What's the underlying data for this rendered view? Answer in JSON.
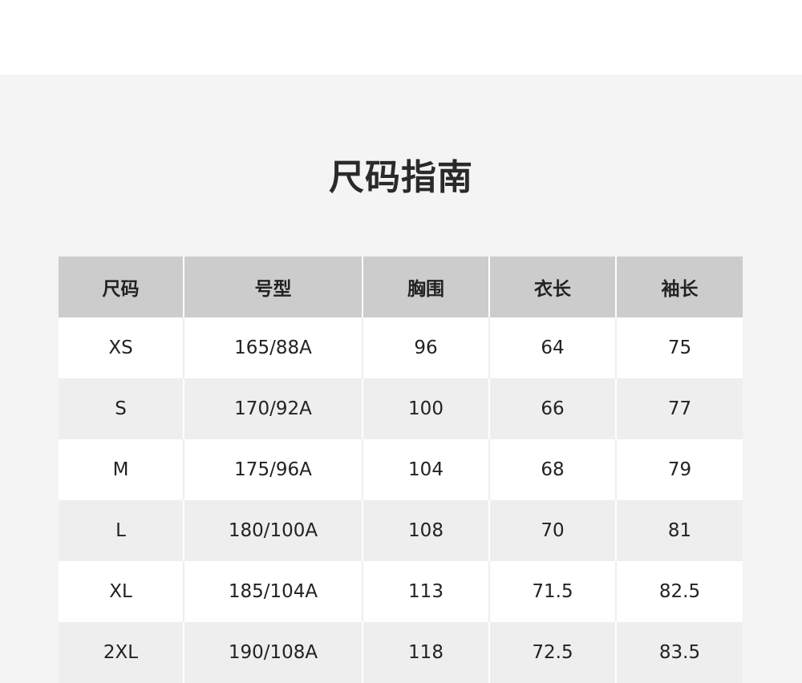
{
  "title": "尺码指南",
  "table": {
    "headers": [
      "尺码",
      "号型",
      "胸围",
      "衣长",
      "袖长"
    ],
    "rows": [
      [
        "XS",
        "165/88A",
        "96",
        "64",
        "75"
      ],
      [
        "S",
        "170/92A",
        "100",
        "66",
        "77"
      ],
      [
        "M",
        "175/96A",
        "104",
        "68",
        "79"
      ],
      [
        "L",
        "180/100A",
        "108",
        "70",
        "81"
      ],
      [
        "XL",
        "185/104A",
        "113",
        "71.5",
        "82.5"
      ],
      [
        "2XL",
        "190/108A",
        "118",
        "72.5",
        "83.5"
      ]
    ]
  },
  "colors": {
    "panel_background": "#f4f4f4",
    "header_background": "#cccccc",
    "row_alt_background": "#eeeeee"
  }
}
